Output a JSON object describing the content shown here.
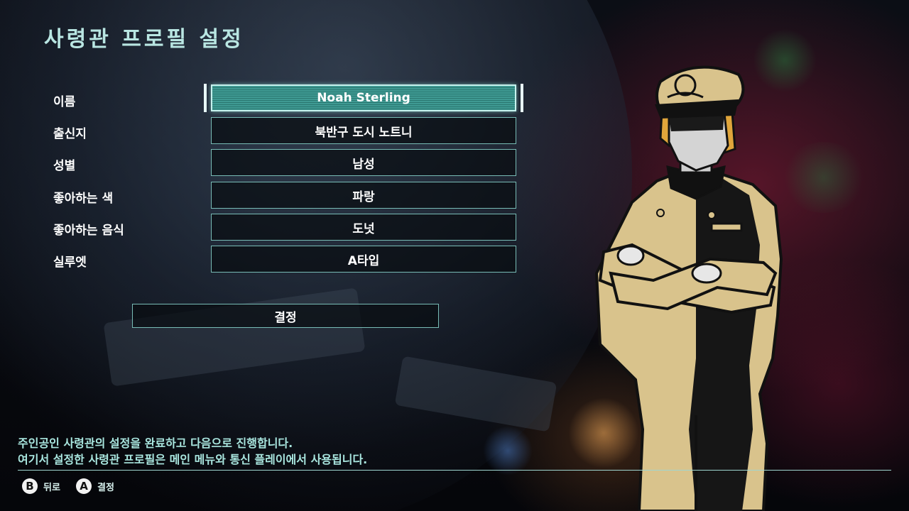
{
  "screen": {
    "title": "사령관 프로필 설정"
  },
  "form": {
    "rows": [
      {
        "label": "이름",
        "value": "Noah Sterling",
        "selected": true
      },
      {
        "label": "출신지",
        "value": "북반구 도시 노트니",
        "selected": false
      },
      {
        "label": "성별",
        "value": "남성",
        "selected": false
      },
      {
        "label": "좋아하는 색",
        "value": "파랑",
        "selected": false
      },
      {
        "label": "좋아하는 음식",
        "value": "도넛",
        "selected": false
      },
      {
        "label": "실루엣",
        "value": "A타입",
        "selected": false
      }
    ],
    "confirm_label": "결정"
  },
  "description": {
    "line1": "주인공인 사령관의 설정을 완료하고 다음으로 진행합니다.",
    "line2": "여기서 설정한 사령관 프로필은 메인 메뉴와 통신 플레이에서 사용됩니다."
  },
  "footer": {
    "back": {
      "glyph": "B",
      "label": "뒤로"
    },
    "confirm": {
      "glyph": "A",
      "label": "결정"
    }
  },
  "character": {
    "cap_emblem_icon": "crest-icon"
  },
  "colors": {
    "accent": "#b9e6e2",
    "field_border": "#78bcb6",
    "selected_fill": "#3f9a93",
    "uniform": "#d9c38c"
  }
}
